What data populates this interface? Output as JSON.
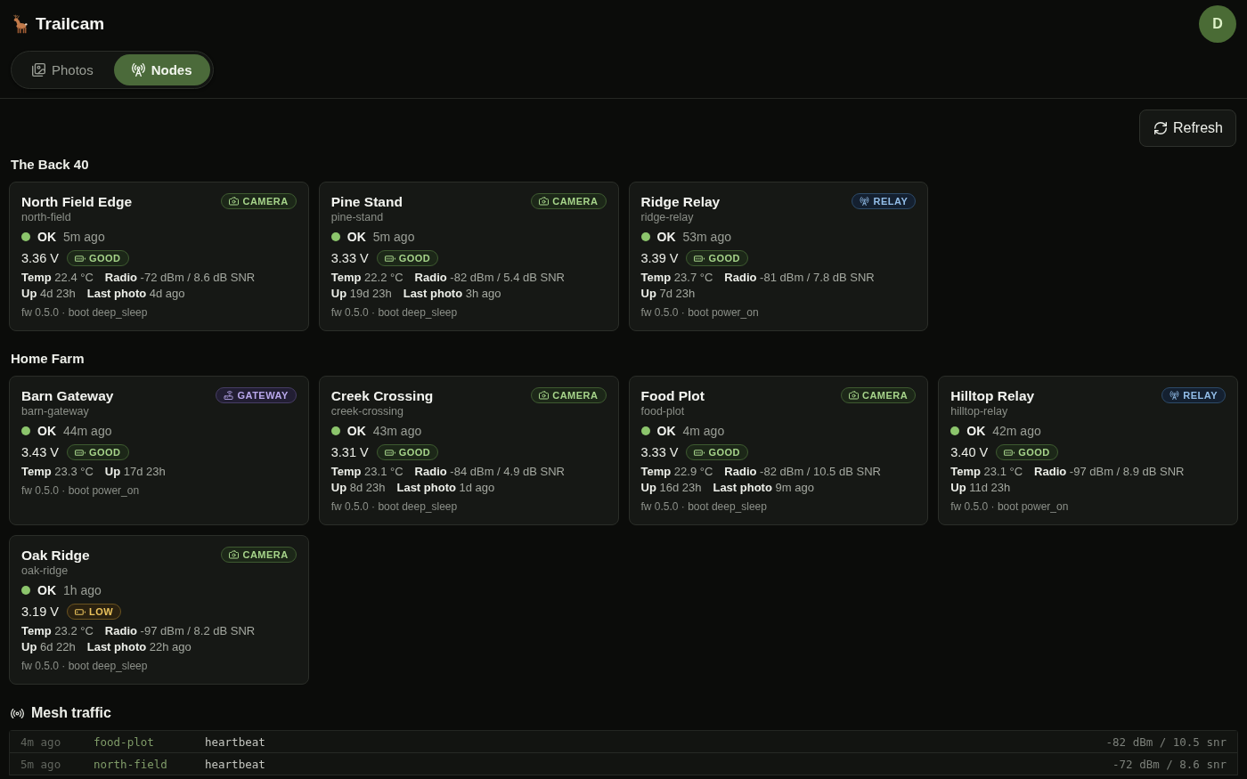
{
  "header": {
    "app_title": "Trailcam",
    "avatar": "D"
  },
  "tabs": [
    {
      "label": "Photos",
      "selected": false
    },
    {
      "label": "Nodes",
      "selected": true
    }
  ],
  "refresh_button": "Refresh",
  "groups": [
    {
      "title": "The Back 40",
      "nodes": [
        {
          "name": "North Field Edge",
          "slug": "north-field",
          "kind": "camera",
          "badge": "CAMERA",
          "status": {
            "label": "OK",
            "color": "#8cc56c"
          },
          "seen": "5m ago",
          "battery": {
            "reading": "3.36 V",
            "label": "GOOD",
            "low": false
          },
          "stats": [
            [
              {
                "label": "Temp",
                "value": "22.4 °C"
              },
              {
                "label": "Radio",
                "value": "-72 dBm / 8.6 dB SNR"
              }
            ],
            [
              {
                "label": "Up",
                "value": "4d 23h"
              },
              {
                "label": "Last photo",
                "value": "4d ago"
              }
            ]
          ],
          "footer": "fw 0.5.0 · boot deep_sleep"
        },
        {
          "name": "Pine Stand",
          "slug": "pine-stand",
          "kind": "camera",
          "badge": "CAMERA",
          "status": {
            "label": "OK",
            "color": "#8cc56c"
          },
          "seen": "5m ago",
          "battery": {
            "reading": "3.33 V",
            "label": "GOOD",
            "low": false
          },
          "stats": [
            [
              {
                "label": "Temp",
                "value": "22.2 °C"
              },
              {
                "label": "Radio",
                "value": "-82 dBm / 5.4 dB SNR"
              }
            ],
            [
              {
                "label": "Up",
                "value": "19d 23h"
              },
              {
                "label": "Last photo",
                "value": "3h ago"
              }
            ]
          ],
          "footer": "fw 0.5.0 · boot deep_sleep"
        },
        {
          "name": "Ridge Relay",
          "slug": "ridge-relay",
          "kind": "relay",
          "badge": "RELAY",
          "status": {
            "label": "OK",
            "color": "#8cc56c"
          },
          "seen": "53m ago",
          "battery": {
            "reading": "3.39 V",
            "label": "GOOD",
            "low": false
          },
          "stats": [
            [
              {
                "label": "Temp",
                "value": "23.7 °C"
              },
              {
                "label": "Radio",
                "value": "-81 dBm / 7.8 dB SNR"
              }
            ],
            [
              {
                "label": "Up",
                "value": "7d 23h"
              }
            ]
          ],
          "footer": "fw 0.5.0 · boot power_on"
        }
      ]
    },
    {
      "title": "Home Farm",
      "nodes": [
        {
          "name": "Barn Gateway",
          "slug": "barn-gateway",
          "kind": "gateway",
          "badge": "GATEWAY",
          "status": {
            "label": "OK",
            "color": "#8cc56c"
          },
          "seen": "44m ago",
          "battery": {
            "reading": "3.43 V",
            "label": "GOOD",
            "low": false
          },
          "stats": [
            [
              {
                "label": "Temp",
                "value": "23.3 °C"
              },
              {
                "label": "Up",
                "value": "17d 23h"
              }
            ]
          ],
          "footer": "fw 0.5.0 · boot power_on"
        },
        {
          "name": "Creek Crossing",
          "slug": "creek-crossing",
          "kind": "camera",
          "badge": "CAMERA",
          "status": {
            "label": "OK",
            "color": "#8cc56c"
          },
          "seen": "43m ago",
          "battery": {
            "reading": "3.31 V",
            "label": "GOOD",
            "low": false
          },
          "stats": [
            [
              {
                "label": "Temp",
                "value": "23.1 °C"
              },
              {
                "label": "Radio",
                "value": "-84 dBm / 4.9 dB SNR"
              }
            ],
            [
              {
                "label": "Up",
                "value": "8d 23h"
              },
              {
                "label": "Last photo",
                "value": "1d ago"
              }
            ]
          ],
          "footer": "fw 0.5.0 · boot deep_sleep"
        },
        {
          "name": "Food Plot",
          "slug": "food-plot",
          "kind": "camera",
          "badge": "CAMERA",
          "status": {
            "label": "OK",
            "color": "#8cc56c"
          },
          "seen": "4m ago",
          "battery": {
            "reading": "3.33 V",
            "label": "GOOD",
            "low": false
          },
          "stats": [
            [
              {
                "label": "Temp",
                "value": "22.9 °C"
              },
              {
                "label": "Radio",
                "value": "-82 dBm / 10.5 dB SNR"
              }
            ],
            [
              {
                "label": "Up",
                "value": "16d 23h"
              },
              {
                "label": "Last photo",
                "value": "9m ago"
              }
            ]
          ],
          "footer": "fw 0.5.0 · boot deep_sleep"
        },
        {
          "name": "Hilltop Relay",
          "slug": "hilltop-relay",
          "kind": "relay",
          "badge": "RELAY",
          "status": {
            "label": "OK",
            "color": "#8cc56c"
          },
          "seen": "42m ago",
          "battery": {
            "reading": "3.40 V",
            "label": "GOOD",
            "low": false
          },
          "stats": [
            [
              {
                "label": "Temp",
                "value": "23.1 °C"
              },
              {
                "label": "Radio",
                "value": "-97 dBm / 8.9 dB SNR"
              }
            ],
            [
              {
                "label": "Up",
                "value": "11d 23h"
              }
            ]
          ],
          "footer": "fw 0.5.0 · boot power_on"
        },
        {
          "name": "Oak Ridge",
          "slug": "oak-ridge",
          "kind": "camera",
          "badge": "CAMERA",
          "status": {
            "label": "OK",
            "color": "#8cc56c"
          },
          "seen": "1h ago",
          "battery": {
            "reading": "3.19 V",
            "label": "LOW",
            "low": true
          },
          "stats": [
            [
              {
                "label": "Temp",
                "value": "23.2 °C"
              },
              {
                "label": "Radio",
                "value": "-97 dBm / 8.2 dB SNR"
              }
            ],
            [
              {
                "label": "Up",
                "value": "6d 22h"
              },
              {
                "label": "Last photo",
                "value": "22h ago"
              }
            ]
          ],
          "footer": "fw 0.5.0 · boot deep_sleep"
        }
      ]
    }
  ],
  "mesh_traffic": {
    "title": "Mesh traffic",
    "rows": [
      {
        "time": "4m ago",
        "node": "food-plot",
        "message": "heartbeat",
        "signal": "-82 dBm / 10.5 snr"
      },
      {
        "time": "5m ago",
        "node": "north-field",
        "message": "heartbeat",
        "signal": "-72 dBm / 8.6 snr"
      }
    ]
  }
}
